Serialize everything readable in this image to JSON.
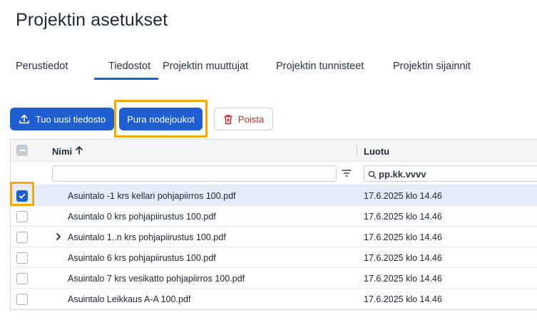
{
  "page": {
    "title": "Projektin asetukset"
  },
  "tabs": [
    {
      "label": "Perustiedot",
      "active": false
    },
    {
      "label": "Tiedostot",
      "active": true
    },
    {
      "label": "Projektin muuttujat",
      "active": false
    },
    {
      "label": "Projektin tunnisteet",
      "active": false
    },
    {
      "label": "Projektin sijainnit",
      "active": false
    }
  ],
  "toolbar": {
    "upload_label": "Tuo uusi tiedosto",
    "unpack_label": "Pura nodejoukot",
    "delete_label": "Poista"
  },
  "table": {
    "columns": {
      "name": "Nimi",
      "created": "Luotu"
    },
    "sort": {
      "column": "name",
      "direction": "ascending"
    },
    "filters": {
      "name_value": "",
      "created_placeholder": "pp.kk.vvvv"
    },
    "rows": [
      {
        "name": "Asuintalo -1 krs kellari pohjapiirros 100.pdf",
        "created": "17.6.2025 klo 14.46",
        "checked": true,
        "expandable": false
      },
      {
        "name": "Asuintalo 0 krs pohjapiirustus 100.pdf",
        "created": "17.6.2025 klo 14.46",
        "checked": false,
        "expandable": false
      },
      {
        "name": "Asuintalo 1..n krs pohjapiirustus 100.pdf",
        "created": "17.6.2025 klo 14.46",
        "checked": false,
        "expandable": true
      },
      {
        "name": "Asuintalo 6 krs pohjapiirustus 100.pdf",
        "created": "17.6.2025 klo 14.46",
        "checked": false,
        "expandable": false
      },
      {
        "name": "Asuintalo 7 krs vesikatto pohjapiirros 100.pdf",
        "created": "17.6.2025 klo 14.46",
        "checked": false,
        "expandable": false
      },
      {
        "name": "Asuintalo Leikkaus A-A 100.pdf",
        "created": "17.6.2025 klo 14.46",
        "checked": false,
        "expandable": false
      }
    ]
  },
  "colors": {
    "primary": "#1f5ed1",
    "highlight": "#f5a800",
    "danger": "#c62828",
    "selected_row": "#e3edf9"
  }
}
